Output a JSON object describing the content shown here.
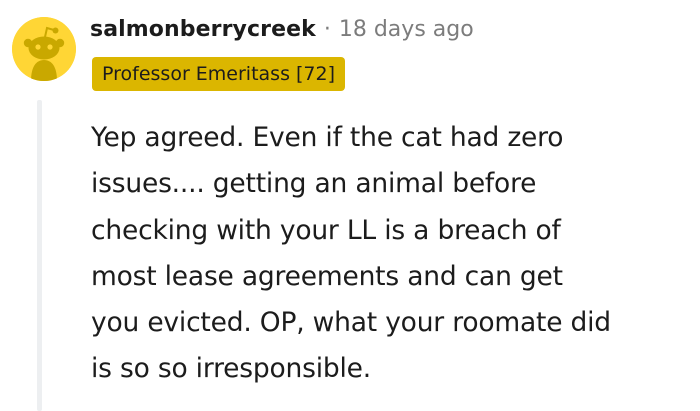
{
  "comment": {
    "author": "salmonberrycreek",
    "separator": "·",
    "timestamp": "18 days ago",
    "flair": "Professor Emeritass [72]",
    "body_lines": [
      "Yep agreed. Even if the cat had zero",
      "issues.... getting an animal before",
      "checking with your LL is a breach of",
      "most lease agreements and can get",
      "you evicted. OP, what your roomate did",
      "is so so irresponsible."
    ]
  },
  "colors": {
    "avatar_bg": "#ffd635",
    "flair_bg": "#dbb600",
    "muted_text": "#7c7c7c",
    "thread_line": "#edeff1"
  },
  "icons": {
    "avatar": "snoo-avatar-icon"
  }
}
